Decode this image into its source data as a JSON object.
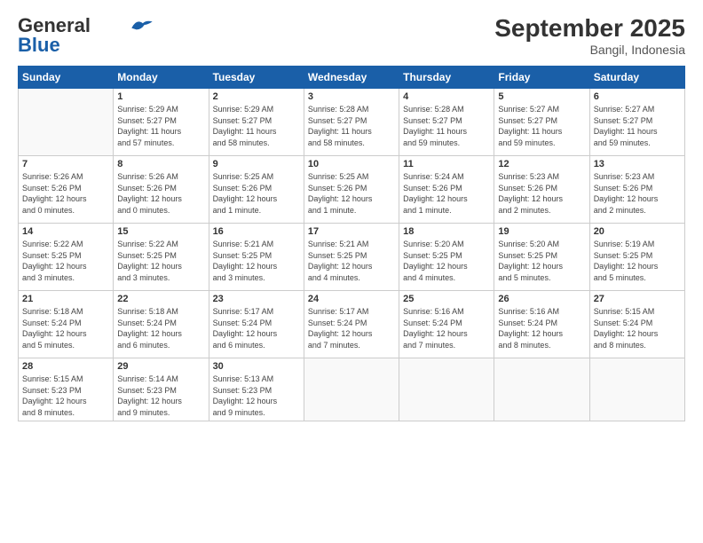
{
  "header": {
    "logo_line1": "General",
    "logo_line2": "Blue",
    "title": "September 2025",
    "subtitle": "Bangil, Indonesia"
  },
  "days_of_week": [
    "Sunday",
    "Monday",
    "Tuesday",
    "Wednesday",
    "Thursday",
    "Friday",
    "Saturday"
  ],
  "weeks": [
    [
      {
        "day": "",
        "lines": []
      },
      {
        "day": "1",
        "lines": [
          "Sunrise: 5:29 AM",
          "Sunset: 5:27 PM",
          "Daylight: 11 hours",
          "and 57 minutes."
        ]
      },
      {
        "day": "2",
        "lines": [
          "Sunrise: 5:29 AM",
          "Sunset: 5:27 PM",
          "Daylight: 11 hours",
          "and 58 minutes."
        ]
      },
      {
        "day": "3",
        "lines": [
          "Sunrise: 5:28 AM",
          "Sunset: 5:27 PM",
          "Daylight: 11 hours",
          "and 58 minutes."
        ]
      },
      {
        "day": "4",
        "lines": [
          "Sunrise: 5:28 AM",
          "Sunset: 5:27 PM",
          "Daylight: 11 hours",
          "and 59 minutes."
        ]
      },
      {
        "day": "5",
        "lines": [
          "Sunrise: 5:27 AM",
          "Sunset: 5:27 PM",
          "Daylight: 11 hours",
          "and 59 minutes."
        ]
      },
      {
        "day": "6",
        "lines": [
          "Sunrise: 5:27 AM",
          "Sunset: 5:27 PM",
          "Daylight: 11 hours",
          "and 59 minutes."
        ]
      }
    ],
    [
      {
        "day": "7",
        "lines": [
          "Sunrise: 5:26 AM",
          "Sunset: 5:26 PM",
          "Daylight: 12 hours",
          "and 0 minutes."
        ]
      },
      {
        "day": "8",
        "lines": [
          "Sunrise: 5:26 AM",
          "Sunset: 5:26 PM",
          "Daylight: 12 hours",
          "and 0 minutes."
        ]
      },
      {
        "day": "9",
        "lines": [
          "Sunrise: 5:25 AM",
          "Sunset: 5:26 PM",
          "Daylight: 12 hours",
          "and 1 minute."
        ]
      },
      {
        "day": "10",
        "lines": [
          "Sunrise: 5:25 AM",
          "Sunset: 5:26 PM",
          "Daylight: 12 hours",
          "and 1 minute."
        ]
      },
      {
        "day": "11",
        "lines": [
          "Sunrise: 5:24 AM",
          "Sunset: 5:26 PM",
          "Daylight: 12 hours",
          "and 1 minute."
        ]
      },
      {
        "day": "12",
        "lines": [
          "Sunrise: 5:23 AM",
          "Sunset: 5:26 PM",
          "Daylight: 12 hours",
          "and 2 minutes."
        ]
      },
      {
        "day": "13",
        "lines": [
          "Sunrise: 5:23 AM",
          "Sunset: 5:26 PM",
          "Daylight: 12 hours",
          "and 2 minutes."
        ]
      }
    ],
    [
      {
        "day": "14",
        "lines": [
          "Sunrise: 5:22 AM",
          "Sunset: 5:25 PM",
          "Daylight: 12 hours",
          "and 3 minutes."
        ]
      },
      {
        "day": "15",
        "lines": [
          "Sunrise: 5:22 AM",
          "Sunset: 5:25 PM",
          "Daylight: 12 hours",
          "and 3 minutes."
        ]
      },
      {
        "day": "16",
        "lines": [
          "Sunrise: 5:21 AM",
          "Sunset: 5:25 PM",
          "Daylight: 12 hours",
          "and 3 minutes."
        ]
      },
      {
        "day": "17",
        "lines": [
          "Sunrise: 5:21 AM",
          "Sunset: 5:25 PM",
          "Daylight: 12 hours",
          "and 4 minutes."
        ]
      },
      {
        "day": "18",
        "lines": [
          "Sunrise: 5:20 AM",
          "Sunset: 5:25 PM",
          "Daylight: 12 hours",
          "and 4 minutes."
        ]
      },
      {
        "day": "19",
        "lines": [
          "Sunrise: 5:20 AM",
          "Sunset: 5:25 PM",
          "Daylight: 12 hours",
          "and 5 minutes."
        ]
      },
      {
        "day": "20",
        "lines": [
          "Sunrise: 5:19 AM",
          "Sunset: 5:25 PM",
          "Daylight: 12 hours",
          "and 5 minutes."
        ]
      }
    ],
    [
      {
        "day": "21",
        "lines": [
          "Sunrise: 5:18 AM",
          "Sunset: 5:24 PM",
          "Daylight: 12 hours",
          "and 5 minutes."
        ]
      },
      {
        "day": "22",
        "lines": [
          "Sunrise: 5:18 AM",
          "Sunset: 5:24 PM",
          "Daylight: 12 hours",
          "and 6 minutes."
        ]
      },
      {
        "day": "23",
        "lines": [
          "Sunrise: 5:17 AM",
          "Sunset: 5:24 PM",
          "Daylight: 12 hours",
          "and 6 minutes."
        ]
      },
      {
        "day": "24",
        "lines": [
          "Sunrise: 5:17 AM",
          "Sunset: 5:24 PM",
          "Daylight: 12 hours",
          "and 7 minutes."
        ]
      },
      {
        "day": "25",
        "lines": [
          "Sunrise: 5:16 AM",
          "Sunset: 5:24 PM",
          "Daylight: 12 hours",
          "and 7 minutes."
        ]
      },
      {
        "day": "26",
        "lines": [
          "Sunrise: 5:16 AM",
          "Sunset: 5:24 PM",
          "Daylight: 12 hours",
          "and 8 minutes."
        ]
      },
      {
        "day": "27",
        "lines": [
          "Sunrise: 5:15 AM",
          "Sunset: 5:24 PM",
          "Daylight: 12 hours",
          "and 8 minutes."
        ]
      }
    ],
    [
      {
        "day": "28",
        "lines": [
          "Sunrise: 5:15 AM",
          "Sunset: 5:23 PM",
          "Daylight: 12 hours",
          "and 8 minutes."
        ]
      },
      {
        "day": "29",
        "lines": [
          "Sunrise: 5:14 AM",
          "Sunset: 5:23 PM",
          "Daylight: 12 hours",
          "and 9 minutes."
        ]
      },
      {
        "day": "30",
        "lines": [
          "Sunrise: 5:13 AM",
          "Sunset: 5:23 PM",
          "Daylight: 12 hours",
          "and 9 minutes."
        ]
      },
      {
        "day": "",
        "lines": []
      },
      {
        "day": "",
        "lines": []
      },
      {
        "day": "",
        "lines": []
      },
      {
        "day": "",
        "lines": []
      }
    ]
  ]
}
